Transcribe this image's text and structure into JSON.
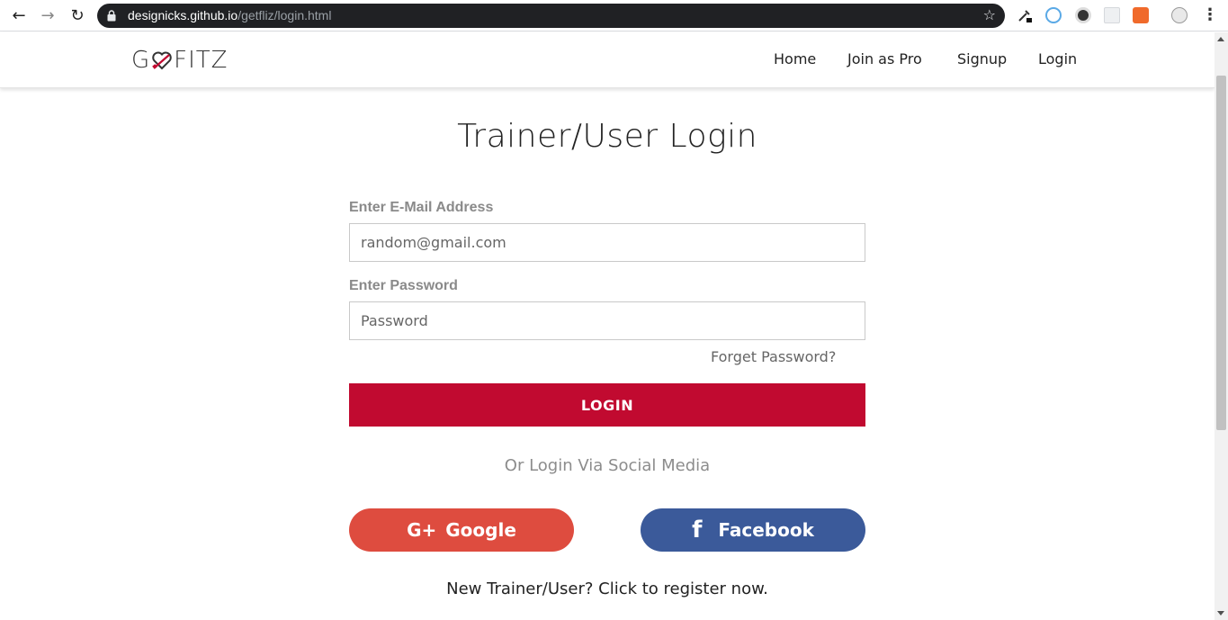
{
  "browser": {
    "url_host": "designicks.github.io",
    "url_path": "/getfliz/login.html",
    "back_icon": "arrow-left-icon",
    "forward_icon": "arrow-right-icon",
    "reload_icon": "reload-icon",
    "lock_icon": "lock-icon",
    "bookmark_icon": "star-icon",
    "menu_icon": "kebab-menu-icon",
    "extension_icons": [
      "eyedropper-icon",
      "circular-arrow-icon",
      "half-moon-icon",
      "grid-icon",
      "tag-icon",
      "avatar-icon"
    ]
  },
  "header": {
    "logo_left": "G",
    "logo_right": "FITZ",
    "nav": [
      "Home",
      "Join as Pro",
      "Signup",
      "Login"
    ]
  },
  "login": {
    "title": "Trainer/User Login",
    "email_label": "Enter E-Mail Address",
    "email_placeholder": "random@gmail.com",
    "password_label": "Enter Password",
    "password_placeholder": "Password",
    "forget_link": "Forget Password?",
    "login_button": "LOGIN",
    "social_caption": "Or Login Via Social Media",
    "google_icon_text": "G+",
    "google_label": "Google",
    "facebook_icon_text": "f",
    "facebook_label": "Facebook",
    "register_text": "New Trainer/User? Click to register now."
  },
  "colors": {
    "login_button": "#c10a30",
    "google_button": "#de4c3f",
    "facebook_button": "#3b5a9a",
    "omnibox": "#202124",
    "label_gray": "#8a8a8a"
  }
}
